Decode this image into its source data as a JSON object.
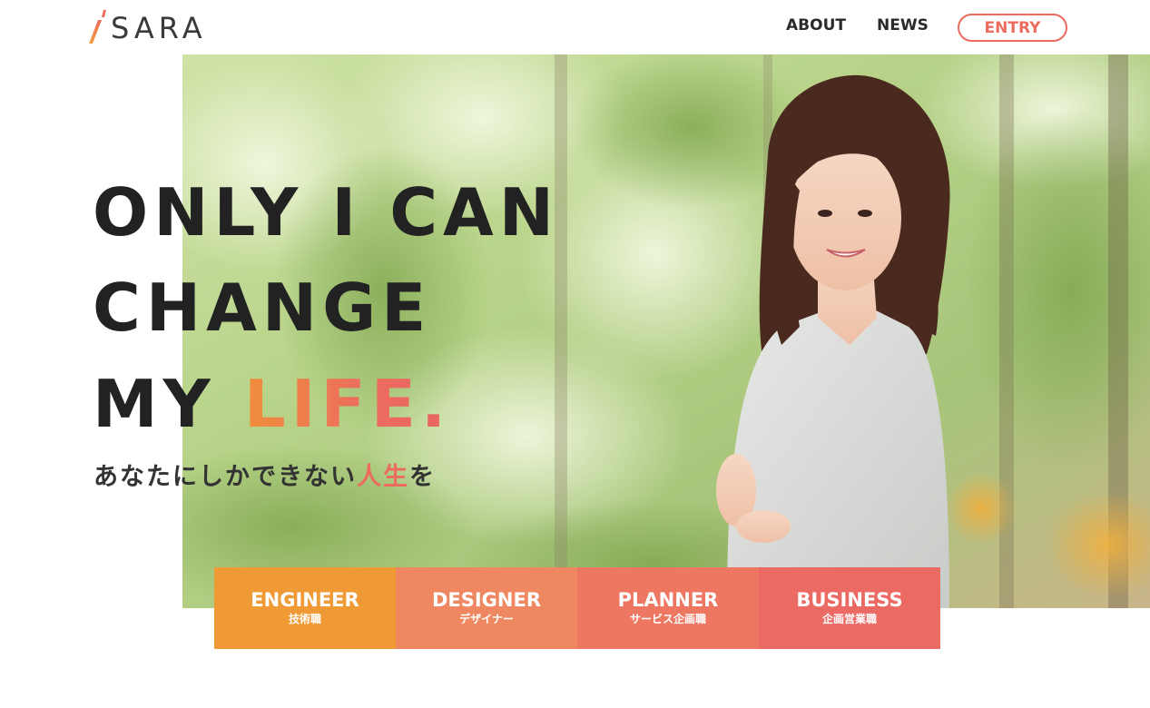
{
  "header": {
    "logo_text": "SARA",
    "nav": {
      "about": "ABOUT",
      "news": "NEWS",
      "entry": "ENTRY"
    }
  },
  "hero": {
    "headline_line1": "ONLY I CAN",
    "headline_line2": "CHANGE",
    "headline_line3_prefix": "MY ",
    "headline_line3_accent": "LIFE.",
    "subheadline_prefix": "あなたにしかできない",
    "subheadline_accent": "人生",
    "subheadline_suffix": "を",
    "photo": "smiling-woman-in-park-photo"
  },
  "tiles": [
    {
      "title": "ENGINEER",
      "subtitle": "技術職",
      "color": "#f09a35"
    },
    {
      "title": "DESIGNER",
      "subtitle": "デザイナー",
      "color": "#ef8860"
    },
    {
      "title": "PLANNER",
      "subtitle": "サービス企画職",
      "color": "#ee7762"
    },
    {
      "title": "BUSINESS",
      "subtitle": "企画営業職",
      "color": "#ec6a64"
    }
  ],
  "colors": {
    "accent": "#ec6b5f",
    "accent_orange": "#ef8f3b",
    "text_dark": "#222222"
  }
}
